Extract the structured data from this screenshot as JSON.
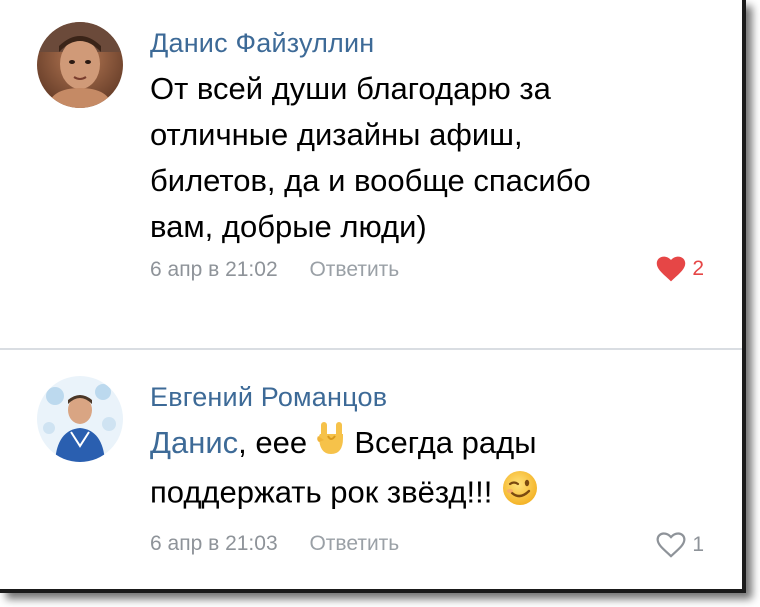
{
  "comments": [
    {
      "author": "Данис Файзуллин",
      "text_lines": [
        "От всей души благодарю за",
        "отличные дизайны афиш,",
        "билетов, да и вообще спасибо",
        "вам, добрые люди)"
      ],
      "timestamp": "6 апр в 21:02",
      "reply_label": "Ответить",
      "likes": "2",
      "liked": true,
      "avatar": "person-photo"
    },
    {
      "author": "Евгений Романцов",
      "mention": "Данис",
      "text_after_mention": ", еее",
      "emoji1": "rock-hand-emoji",
      "text_line1_end": "Всегда рады",
      "text_line2": "поддержать рок звёзд!!!",
      "emoji2": "winking-face-emoji",
      "timestamp": "6 апр в 21:03",
      "reply_label": "Ответить",
      "likes": "1",
      "liked": false,
      "avatar": "person-photo-blue-background"
    }
  ],
  "colors": {
    "author": "#3d6a97",
    "meta": "#8e9399",
    "like_active": "#e64646",
    "divider": "#d9dde2"
  }
}
